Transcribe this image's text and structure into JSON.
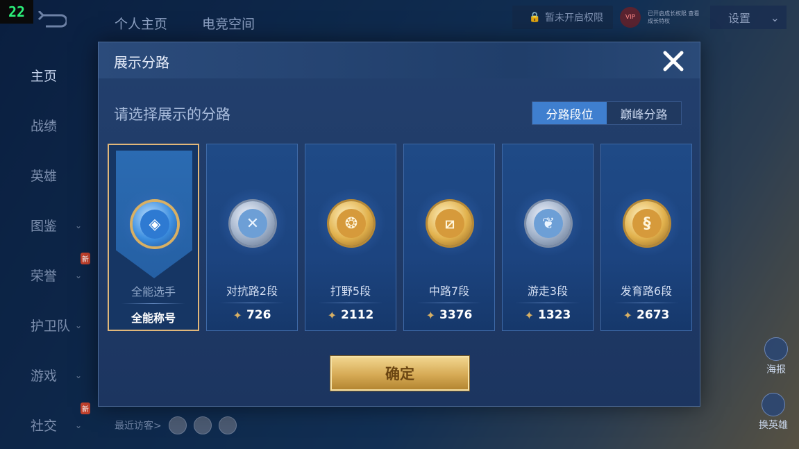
{
  "badge": "22",
  "top_tabs": [
    "个人主页",
    "电竞空间"
  ],
  "top_right": {
    "permission_text": "暂未开启权限",
    "vip_label": "VIP",
    "vip_note": "已开启成长权限 查看成长特权",
    "settings_label": "设置"
  },
  "sidebar": {
    "items": [
      {
        "label": "主页",
        "chevron": "",
        "new": ""
      },
      {
        "label": "战绩",
        "chevron": "",
        "new": ""
      },
      {
        "label": "英雄",
        "chevron": "",
        "new": ""
      },
      {
        "label": "图鉴",
        "chevron": "⌄",
        "new": ""
      },
      {
        "label": "荣誉",
        "chevron": "⌄",
        "new": "新"
      },
      {
        "label": "护卫队",
        "chevron": "⌄",
        "new": ""
      },
      {
        "label": "游戏",
        "chevron": "⌄",
        "new": ""
      },
      {
        "label": "社交",
        "chevron": "⌄",
        "new": "新"
      }
    ]
  },
  "visitors": {
    "label": "最近访客>"
  },
  "right_actions": {
    "poster": "海报",
    "change_hero": "换英雄"
  },
  "modal": {
    "title": "展示分路",
    "close_icon": "close-icon",
    "prompt": "请选择展示的分路",
    "segments": {
      "active": "分路段位",
      "inactive": "巅峰分路"
    },
    "confirm_label": "确定"
  },
  "cards": [
    {
      "name": "全能选手",
      "sub": "全能称号",
      "score": "",
      "icon": "allround-icon",
      "glyph": "◈",
      "style": "allround"
    },
    {
      "name": "对抗路2段",
      "sub": "",
      "score": "726",
      "icon": "clash-lane-icon",
      "glyph": "✕",
      "style": "silver"
    },
    {
      "name": "打野5段",
      "sub": "",
      "score": "2112",
      "icon": "jungle-icon",
      "glyph": "❂",
      "style": "gold"
    },
    {
      "name": "中路7段",
      "sub": "",
      "score": "3376",
      "icon": "mid-lane-icon",
      "glyph": "⧄",
      "style": "gold"
    },
    {
      "name": "游走3段",
      "sub": "",
      "score": "1323",
      "icon": "roam-icon",
      "glyph": "❦",
      "style": "silver"
    },
    {
      "name": "发育路6段",
      "sub": "",
      "score": "2673",
      "icon": "farm-lane-icon",
      "glyph": "§",
      "style": "gold"
    }
  ],
  "colors": {
    "accent_blue": "#3f7fcf",
    "gold": "#d8b064",
    "panel": "#23406e"
  }
}
